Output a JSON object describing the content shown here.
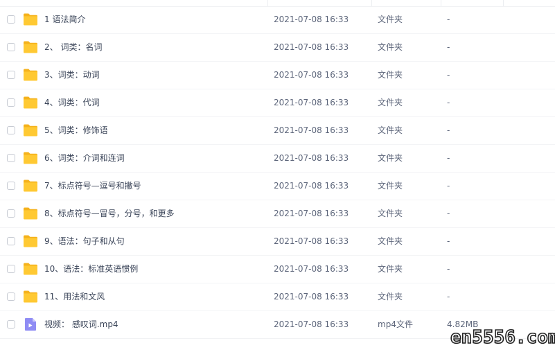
{
  "rows": [
    {
      "name": "1 语法简介",
      "time": "2021-07-08 16:33",
      "type": "文件夹",
      "size": "-",
      "icon": "folder-icon"
    },
    {
      "name": "2、 词类：名词",
      "time": "2021-07-08 16:33",
      "type": "文件夹",
      "size": "-",
      "icon": "folder-icon"
    },
    {
      "name": "3、词类：动词",
      "time": "2021-07-08 16:33",
      "type": "文件夹",
      "size": "-",
      "icon": "folder-icon"
    },
    {
      "name": "4、词类：代词",
      "time": "2021-07-08 16:33",
      "type": "文件夹",
      "size": "-",
      "icon": "folder-icon"
    },
    {
      "name": "5、词类：修饰语",
      "time": "2021-07-08 16:33",
      "type": "文件夹",
      "size": "-",
      "icon": "folder-icon"
    },
    {
      "name": "6、词类：介词和连词",
      "time": "2021-07-08 16:33",
      "type": "文件夹",
      "size": "-",
      "icon": "folder-icon"
    },
    {
      "name": "7、标点符号—逗号和撇号",
      "time": "2021-07-08 16:33",
      "type": "文件夹",
      "size": "-",
      "icon": "folder-icon"
    },
    {
      "name": "8、标点符号—冒号，分号，和更多",
      "time": "2021-07-08 16:33",
      "type": "文件夹",
      "size": "-",
      "icon": "folder-icon"
    },
    {
      "name": "9、语法：句子和从句",
      "time": "2021-07-08 16:33",
      "type": "文件夹",
      "size": "-",
      "icon": "folder-icon"
    },
    {
      "name": "10、语法：标准英语惯例",
      "time": "2021-07-08 16:33",
      "type": "文件夹",
      "size": "-",
      "icon": "folder-icon"
    },
    {
      "name": "11、用法和文风",
      "time": "2021-07-08 16:33",
      "type": "文件夹",
      "size": "-",
      "icon": "folder-icon"
    },
    {
      "name": "视频： 感叹词.mp4",
      "time": "2021-07-08 16:33",
      "type": "mp4文件",
      "size": "4.82MB",
      "icon": "video-file-icon"
    }
  ],
  "watermark": "en5556.com",
  "colors": {
    "folder": "#ffc933",
    "folder_dark": "#f5b21c",
    "video": "#8f8cf4"
  }
}
